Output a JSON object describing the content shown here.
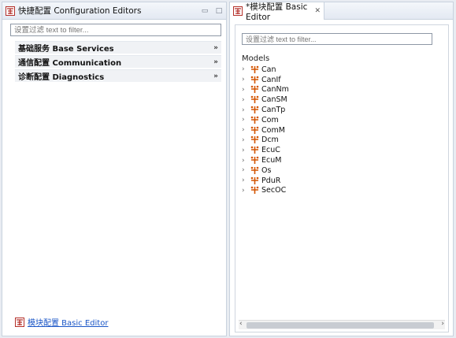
{
  "left_view": {
    "tab_title": "快捷配置 Configuration Editors",
    "filter_placeholder": "设置过滤 text to filter...",
    "sections": [
      {
        "label": "基础服务 Base Services"
      },
      {
        "label": "通信配置 Communication"
      },
      {
        "label": "诊断配置 Diagnostics"
      }
    ],
    "footer_link": "模块配置 Basic Editor"
  },
  "right_view": {
    "tab_title": "*模块配置 Basic Editor",
    "filter_placeholder": "设置过滤 text to filter...",
    "models_label": "Models",
    "modules": [
      "Can",
      "CanIf",
      "CanNm",
      "CanSM",
      "CanTp",
      "Com",
      "ComM",
      "Dcm",
      "EcuC",
      "EcuM",
      "Os",
      "PduR",
      "SecOC"
    ]
  },
  "colors": {
    "accent": "#d35400",
    "link": "#1a56c7",
    "logo_red": "#b5302a"
  }
}
